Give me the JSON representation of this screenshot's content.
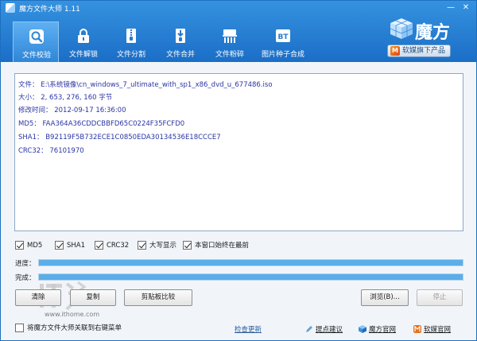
{
  "window": {
    "title": "魔方文件大师 1.11",
    "minimize_glyph": "—",
    "close_glyph": "✕"
  },
  "toolbar": {
    "tabs": [
      {
        "label": "文件校验",
        "icon": "magnifier-shield-icon",
        "active": true
      },
      {
        "label": "文件解锁",
        "icon": "lock-icon",
        "active": false
      },
      {
        "label": "文件分割",
        "icon": "zip-split-icon",
        "active": false
      },
      {
        "label": "文件合并",
        "icon": "zip-merge-icon",
        "active": false
      },
      {
        "label": "文件粉碎",
        "icon": "shredder-icon",
        "active": false
      },
      {
        "label": "图片种子合成",
        "icon": "bt-icon",
        "active": false
      }
    ]
  },
  "brand": {
    "logo_text": "魔方",
    "badge_letter": "M",
    "badge_text": "软媒旗下产品"
  },
  "result": {
    "file_label": "文件：",
    "file_value": "E:\\系统镜像\\cn_windows_7_ultimate_with_sp1_x86_dvd_u_677486.iso",
    "size_label": "大小：",
    "size_value": "2, 653, 276, 160 字节",
    "modified_label": "修改时间：",
    "modified_value": "2012-09-17 16:36:00",
    "md5_label": "MD5：",
    "md5_value": "FAA364A36CDDCBBFD65C0224F35FCFD0",
    "sha1_label": "SHA1：",
    "sha1_value": "B92119F5B732ECE1C0850EDA30134536E18CCCE7",
    "crc32_label": "CRC32：",
    "crc32_value": "76101970"
  },
  "options": {
    "md5": {
      "label": "MD5",
      "checked": true
    },
    "sha1": {
      "label": "SHA1",
      "checked": true
    },
    "crc32": {
      "label": "CRC32",
      "checked": true
    },
    "uppercase": {
      "label": "大写显示",
      "checked": true
    },
    "topmost": {
      "label": "本窗口始终在最前",
      "checked": true
    }
  },
  "progress": {
    "progress_label": "进度：",
    "progress_value": 1.0,
    "complete_label": "完成：",
    "complete_value": 1.0
  },
  "buttons": {
    "clear": "清除",
    "copy": "复制",
    "compare": "剪贴板比较",
    "browse": "浏览(B)...",
    "stop": "停止"
  },
  "footer": {
    "context_menu_label": "将魔方文件大师关联到右键菜单",
    "check_update": "检查更新",
    "feedback": "提点建议",
    "mofang_site": "魔方官网",
    "ruanmei_site": "软媒官网"
  },
  "watermark": {
    "url": "www.ithome.com"
  },
  "colors": {
    "header_top": "#3592e0",
    "header_bottom": "#1b6ec6",
    "result_text": "#2b34a5",
    "progress_fill": "#5aaee9"
  }
}
